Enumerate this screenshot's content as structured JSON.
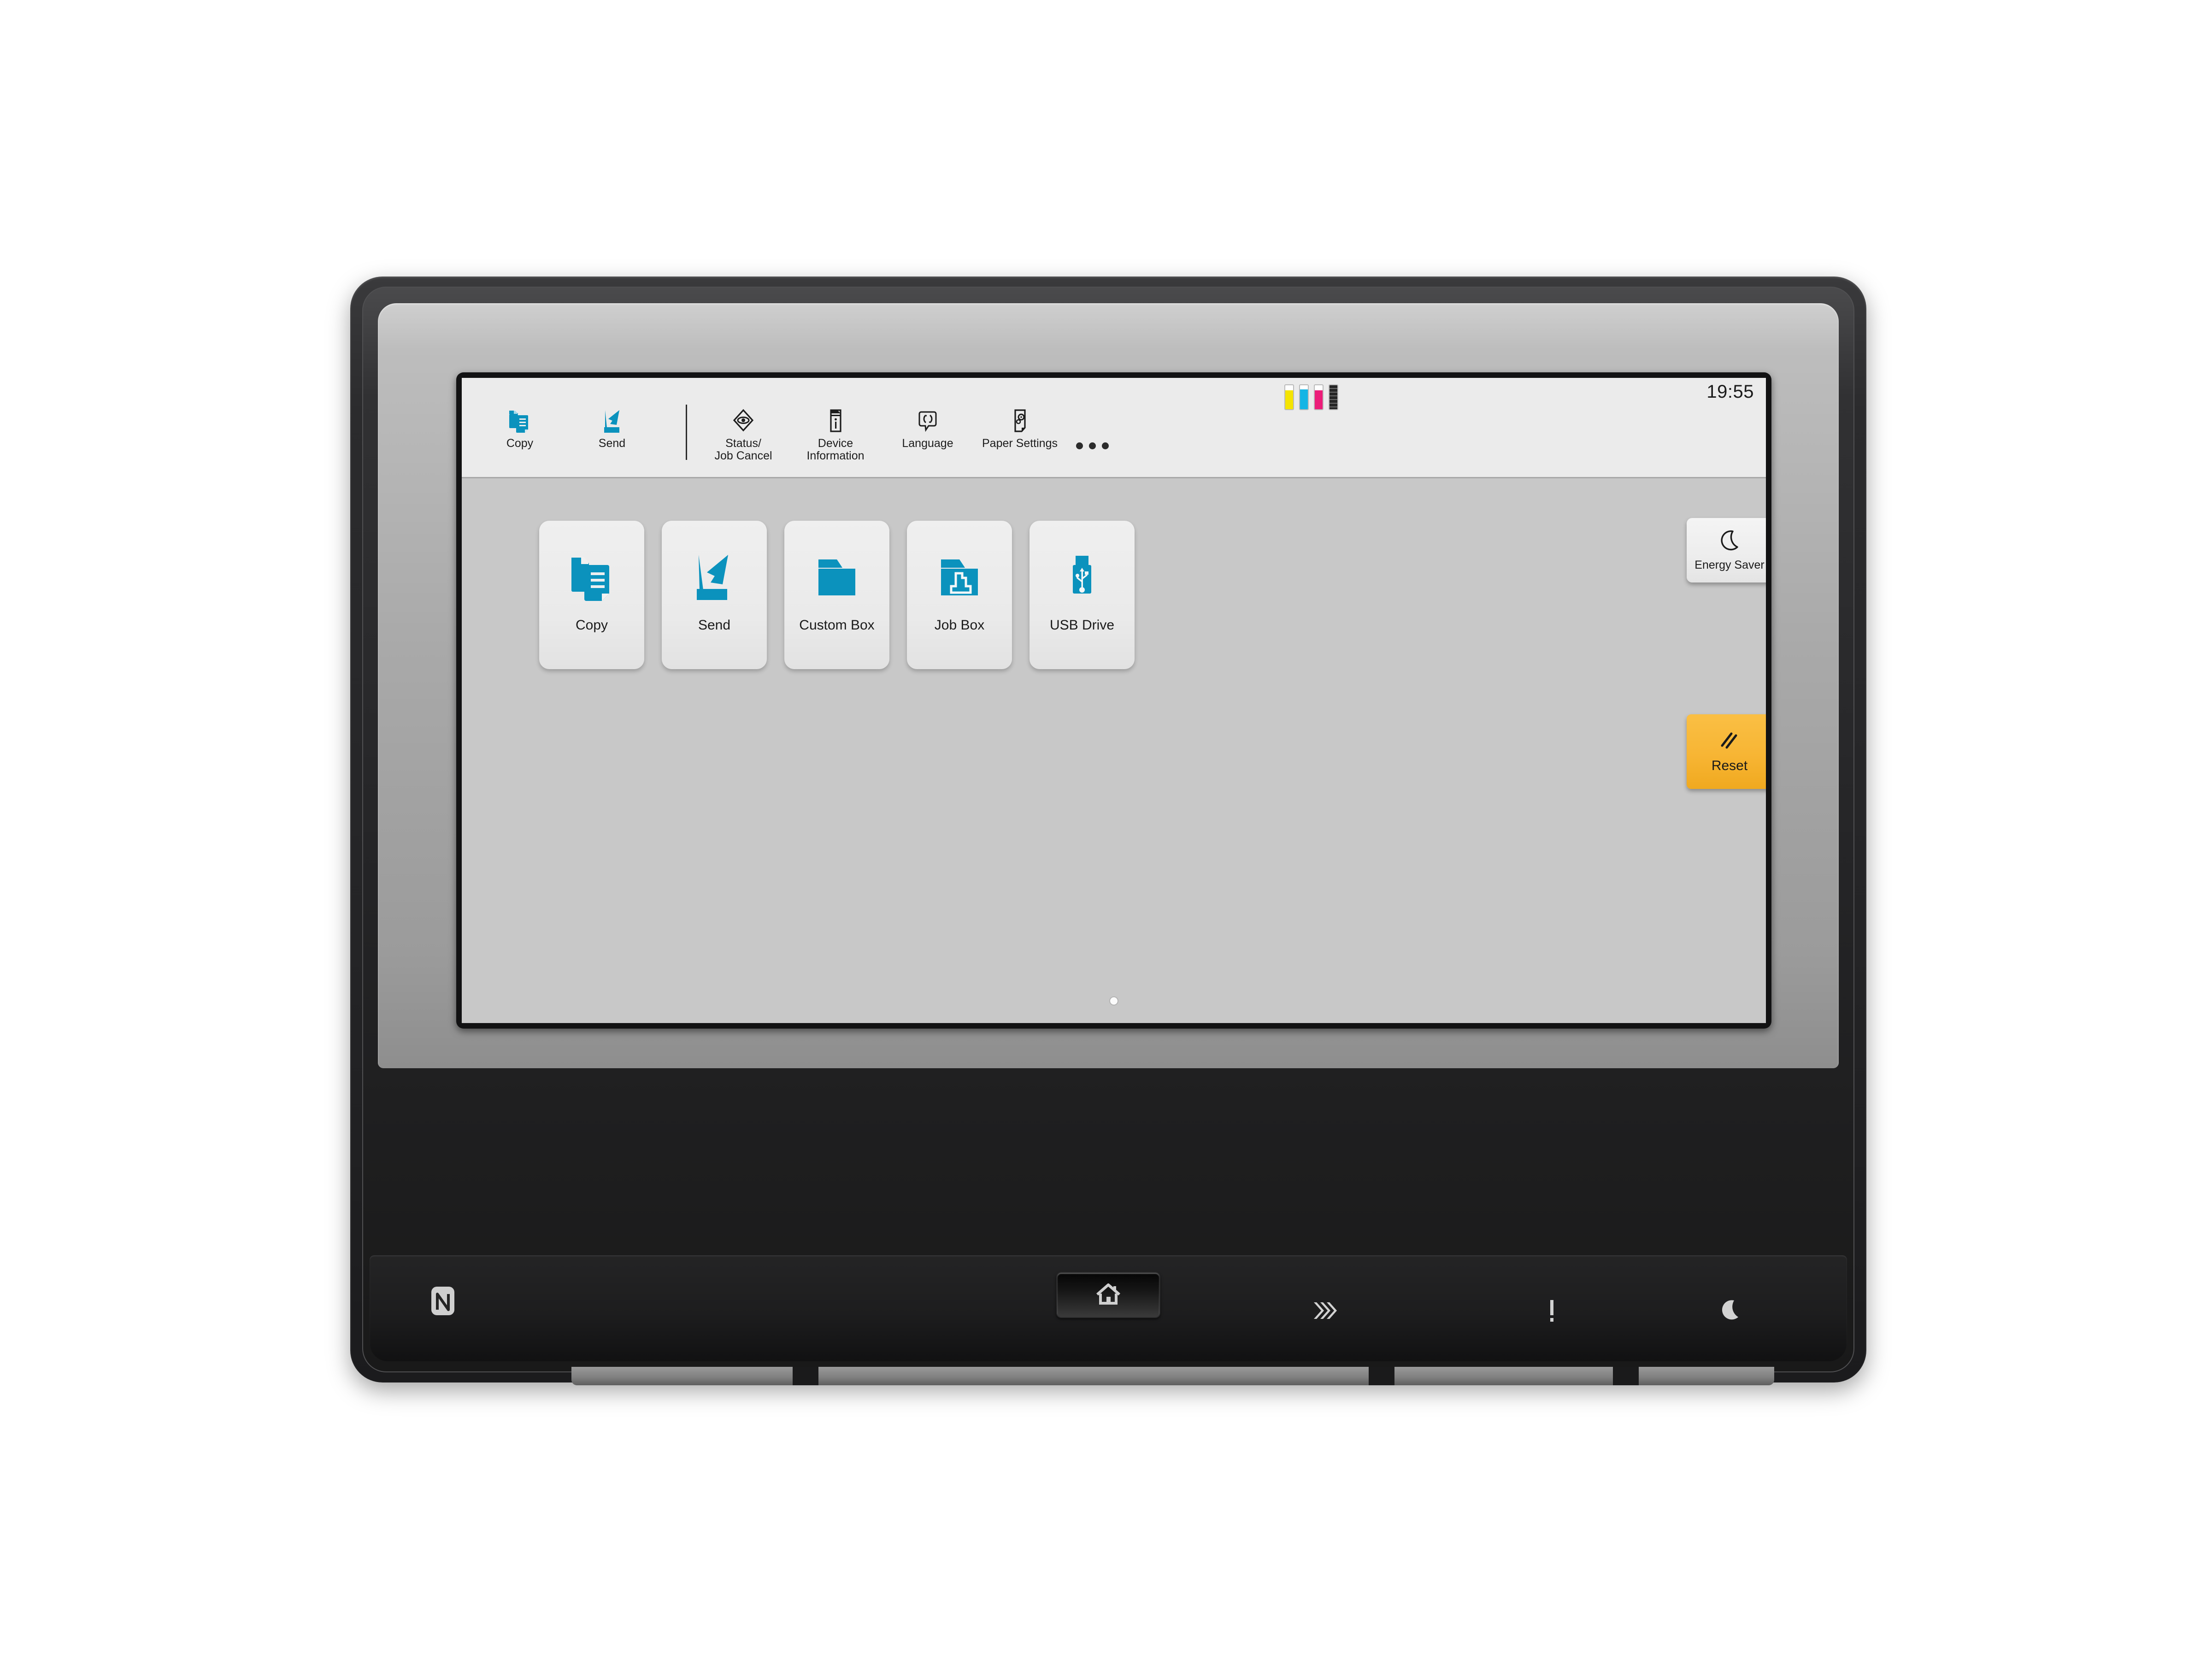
{
  "screen": {
    "status": {
      "time": "19:55",
      "toner": [
        {
          "name": "yellow",
          "color": "#f5e400",
          "level": 78
        },
        {
          "name": "cyan",
          "color": "#15b5e5",
          "level": 82
        },
        {
          "name": "magenta",
          "color": "#ec1e79",
          "level": 78
        },
        {
          "name": "black",
          "color": "#242424",
          "level": 100
        }
      ]
    },
    "toolbar": {
      "shortcuts": [
        {
          "label": "Copy",
          "icon": "copy-icon"
        },
        {
          "label": "Send",
          "icon": "send-icon"
        }
      ],
      "functions": [
        {
          "label": "Status/\nJob Cancel",
          "icon": "status-eye-icon"
        },
        {
          "label": "Device\nInformation",
          "icon": "device-info-icon"
        },
        {
          "label": "Language",
          "icon": "language-icon"
        },
        {
          "label": "Paper Settings",
          "icon": "paper-settings-icon"
        }
      ],
      "more_label": "more-options"
    },
    "home_tiles": [
      {
        "label": "Copy",
        "icon": "copy-documents-icon"
      },
      {
        "label": "Send",
        "icon": "send-scan-icon"
      },
      {
        "label": "Custom Box",
        "icon": "folder-icon"
      },
      {
        "label": "Job Box",
        "icon": "folder-print-icon"
      },
      {
        "label": "USB Drive",
        "icon": "usb-drive-icon"
      }
    ],
    "hard_keys": {
      "energy_saver": {
        "label": "Energy Saver",
        "icon": "moon-icon"
      },
      "reset": {
        "label": "Reset",
        "icon": "double-slash-icon",
        "color": "#f7b534"
      }
    },
    "pagination": {
      "pages": 1,
      "active": 0
    }
  },
  "panel": {
    "nfc": {
      "label": "NFC",
      "icon": "nfc-icon"
    },
    "home_button": {
      "label": "Home",
      "icon": "home-icon"
    },
    "indicators": [
      {
        "name": "processing-led",
        "icon": "chevrons-icon"
      },
      {
        "name": "attention-led",
        "icon": "exclamation-icon"
      },
      {
        "name": "energy-saver-led",
        "icon": "moon-icon"
      }
    ]
  },
  "theme": {
    "accent_blue": "#0b92bd",
    "reset_orange": "#f7b534",
    "screen_bg": "#c8c8c8",
    "topbar_bg": "#ebebeb"
  }
}
